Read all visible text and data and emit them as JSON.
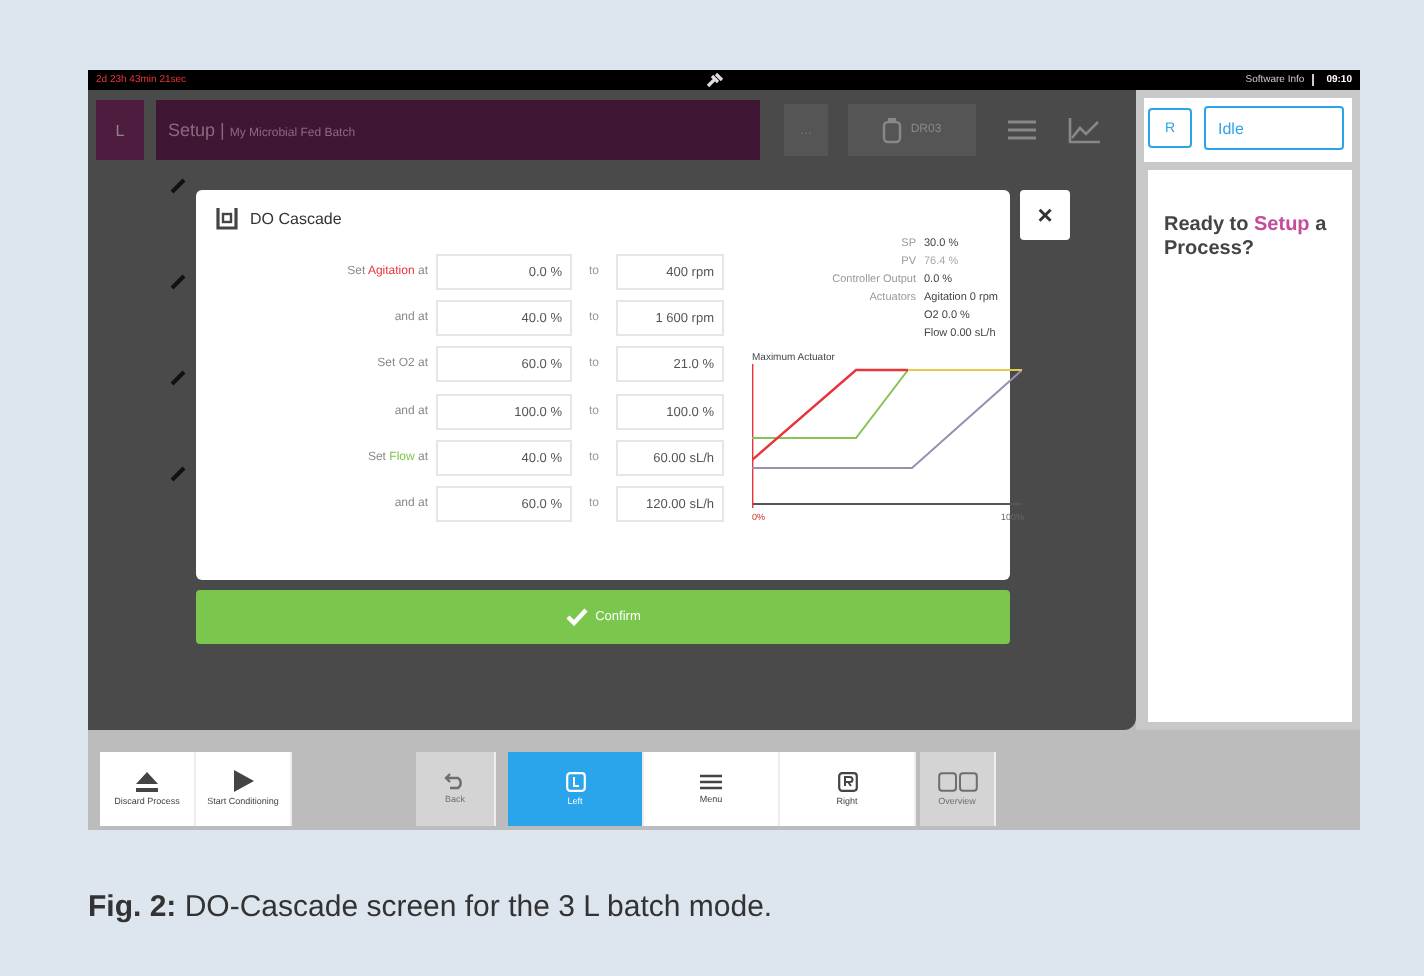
{
  "status_bar": {
    "runtime": "2d 23h 43min 21sec",
    "user": "Software Info",
    "time": "09:10"
  },
  "header": {
    "unit_button": "L",
    "title": "Setup",
    "separator": "|",
    "subtitle": "My Microbial Fed Batch",
    "more_button": "...",
    "device": "DR03"
  },
  "side_panel": {
    "unit_button": "R",
    "state": "Idle",
    "message": "Ready to **Setup** a Process?"
  },
  "dialog": {
    "title": "DO Cascade",
    "rows": [
      {
        "label_parts": [
          "Set ",
          "Agitation",
          " at"
        ],
        "color": "#e8343c",
        "from": "0.0 %",
        "to_word": "to",
        "to": "400 rpm"
      },
      {
        "label_parts": [
          "and at"
        ],
        "from": "40.0 %",
        "to_word": "to",
        "to": "1 600 rpm"
      },
      {
        "label_parts": [
          "Set O2 at"
        ],
        "from": "60.0 %",
        "to_word": "to",
        "to": "21.0 %"
      },
      {
        "label_parts": [
          "and at"
        ],
        "from": "100.0 %",
        "to_word": "to",
        "to": "100.0 %"
      },
      {
        "label_parts": [
          "Set ",
          "Flow",
          " at"
        ],
        "color": "#7cc84a",
        "from": "40.0 %",
        "to_word": "to",
        "to": "60.00 sL/h"
      },
      {
        "label_parts": [
          "and at"
        ],
        "from": "60.0 %",
        "to_word": "to",
        "to": "120.00 sL/h"
      }
    ],
    "readings": [
      {
        "label": "SP",
        "values": [
          "30.0 %"
        ],
        "dim": false
      },
      {
        "label": "PV",
        "values": [
          "76.4 %"
        ],
        "dim": true
      },
      {
        "label": "Controller Output",
        "values": [
          "0.0 %"
        ],
        "dim": false
      },
      {
        "label": "Actuators",
        "values": [
          "Agitation 0 rpm",
          "O2 0.0 %",
          "Flow 0.00 sL/h"
        ],
        "dim": false
      }
    ],
    "chart": {
      "title": "Maximum Actuator",
      "x_start": "0%",
      "x_end": "100%"
    },
    "close_button": "×",
    "confirm_button": "Confirm"
  },
  "toolbar": [
    {
      "label": "Discard Process",
      "kind": "eject",
      "selected": false,
      "disabled": false
    },
    {
      "label": "Start Conditioning",
      "kind": "play",
      "selected": false,
      "disabled": false
    },
    {
      "label": "Back",
      "kind": "undo",
      "selected": false,
      "disabled": true
    },
    {
      "label": "Left",
      "kind": "left",
      "selected": true,
      "disabled": false
    },
    {
      "label": "Menu",
      "kind": "menu",
      "selected": false,
      "disabled": false
    },
    {
      "label": "Right",
      "kind": "right",
      "selected": false,
      "disabled": false
    },
    {
      "label": "Overview",
      "kind": "overview",
      "selected": false,
      "disabled": true
    }
  ],
  "caption": "**Fig. 2:** DO-Cascade screen for the 3 L batch mode."
}
